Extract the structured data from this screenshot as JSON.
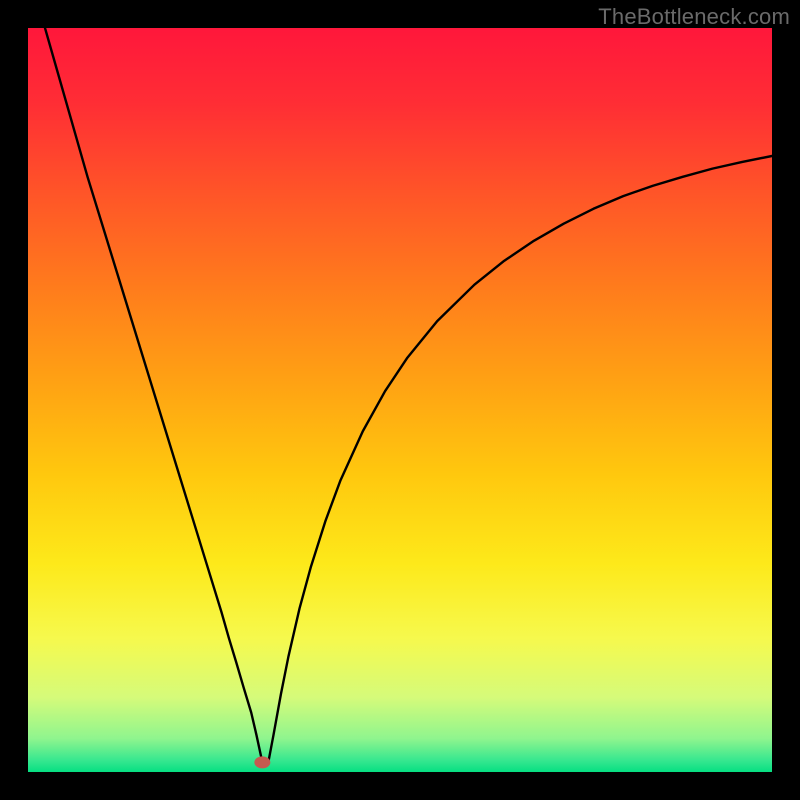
{
  "watermark": "TheBottleneck.com",
  "chart_data": {
    "type": "line",
    "title": "",
    "xlabel": "",
    "ylabel": "",
    "xlim": [
      0,
      100
    ],
    "ylim": [
      0,
      100
    ],
    "grid": false,
    "legend": false,
    "background_gradient": {
      "stops": [
        {
          "offset": 0.0,
          "color": "#ff173b"
        },
        {
          "offset": 0.1,
          "color": "#ff2d35"
        },
        {
          "offset": 0.22,
          "color": "#ff5428"
        },
        {
          "offset": 0.35,
          "color": "#ff7c1c"
        },
        {
          "offset": 0.48,
          "color": "#ffa313"
        },
        {
          "offset": 0.6,
          "color": "#ffc80e"
        },
        {
          "offset": 0.72,
          "color": "#fde91a"
        },
        {
          "offset": 0.82,
          "color": "#f6f94d"
        },
        {
          "offset": 0.9,
          "color": "#d5fb7a"
        },
        {
          "offset": 0.955,
          "color": "#8ff58e"
        },
        {
          "offset": 0.985,
          "color": "#35e78f"
        },
        {
          "offset": 1.0,
          "color": "#06df82"
        }
      ]
    },
    "marker": {
      "x": 31.5,
      "y": 1.3,
      "color": "#c65a4f"
    },
    "series": [
      {
        "name": "curve",
        "x": [
          0,
          2,
          4,
          6,
          8,
          10,
          12,
          14,
          16,
          18,
          20,
          22,
          24,
          26,
          27,
          28,
          29,
          30,
          30.7,
          31.5,
          32.3,
          33,
          34,
          35,
          36.5,
          38,
          40,
          42,
          45,
          48,
          51,
          55,
          60,
          64,
          68,
          72,
          76,
          80,
          84,
          88,
          92,
          96,
          100
        ],
        "y": [
          108,
          101,
          94,
          87,
          80,
          73.5,
          67,
          60.5,
          54,
          47.5,
          41,
          34.5,
          28,
          21.5,
          18,
          14.7,
          11.3,
          8,
          5,
          1.3,
          1.3,
          5,
          10.5,
          15.5,
          22,
          27.5,
          33.8,
          39.2,
          45.8,
          51.2,
          55.7,
          60.6,
          65.5,
          68.7,
          71.4,
          73.7,
          75.7,
          77.4,
          78.8,
          80.0,
          81.1,
          82.0,
          82.8
        ]
      }
    ]
  }
}
